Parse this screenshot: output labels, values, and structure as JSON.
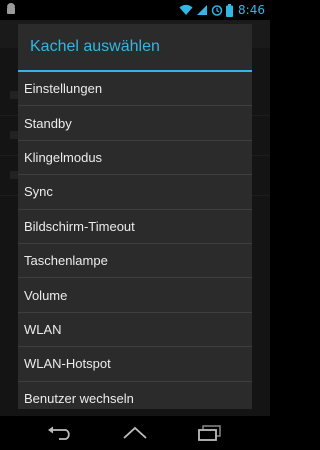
{
  "status_bar": {
    "time": "8:46",
    "icons": [
      "android-notification-icon",
      "wifi-icon",
      "signal-icon",
      "alarm-icon",
      "battery-icon"
    ]
  },
  "dialog": {
    "title": "Kachel auswählen",
    "items": [
      {
        "label": "Einstellungen"
      },
      {
        "label": "Standby"
      },
      {
        "label": "Klingelmodus"
      },
      {
        "label": "Sync"
      },
      {
        "label": "Bildschirm-Timeout"
      },
      {
        "label": "Taschenlampe"
      },
      {
        "label": "Volume"
      },
      {
        "label": "WLAN"
      },
      {
        "label": "WLAN-Hotspot"
      },
      {
        "label": "Benutzer wechseln"
      }
    ]
  },
  "nav_bar": {
    "buttons": [
      "back-icon",
      "home-icon",
      "recent-apps-icon"
    ]
  },
  "colors": {
    "accent": "#33b5e5",
    "dialog_bg": "#2b2b2b",
    "divider": "#3e3e3e",
    "background": "#000000"
  }
}
